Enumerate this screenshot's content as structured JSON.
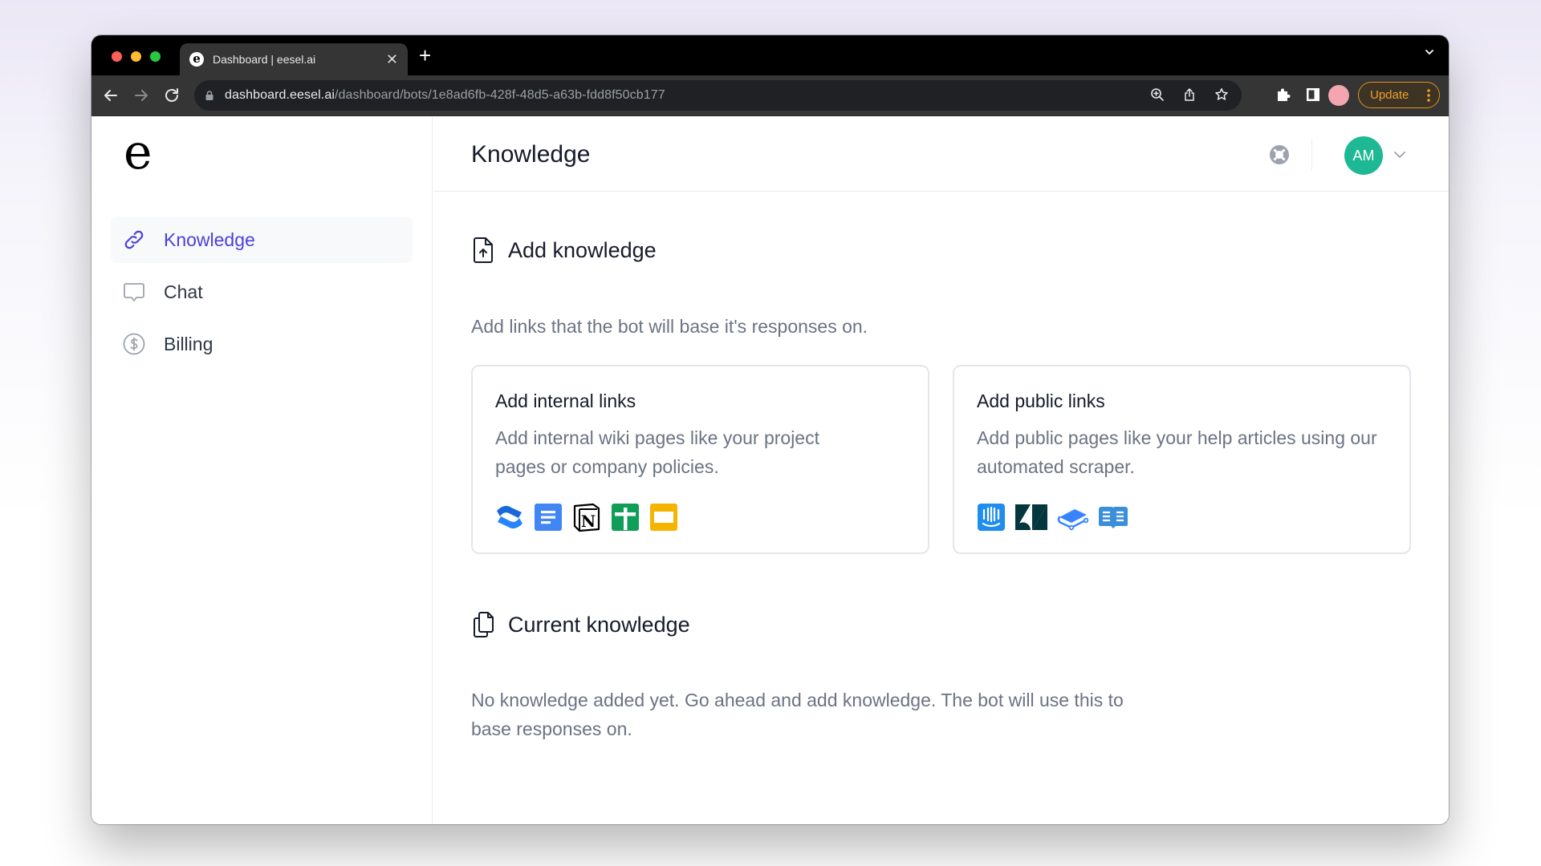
{
  "browser": {
    "tab": {
      "title": "Dashboard | eesel.ai",
      "favicon": "eesel-logo-icon"
    },
    "url": {
      "host": "dashboard.eesel.ai",
      "path": "/dashboard/bots/1e8ad6fb-428f-48d5-a63b-fdd8f50cb177"
    },
    "update_label": "Update",
    "icons": [
      "back-icon",
      "forward-icon",
      "reload-icon",
      "lock-icon",
      "zoom-icon",
      "share-icon",
      "bookmark-star-icon",
      "extensions-icon",
      "side-panel-icon",
      "profile-icon",
      "kebab-menu-icon"
    ]
  },
  "app": {
    "logo": "e",
    "sidebar": {
      "items": [
        {
          "label": "Knowledge",
          "icon": "link-icon",
          "active": true
        },
        {
          "label": "Chat",
          "icon": "chat-bubble-icon",
          "active": false
        },
        {
          "label": "Billing",
          "icon": "dollar-circle-icon",
          "active": false
        }
      ]
    },
    "header": {
      "title": "Knowledge",
      "help_icon": "lifebuoy-icon",
      "avatar_initials": "AM",
      "avatar_color": "#1fb894"
    },
    "add_knowledge": {
      "title": "Add knowledge",
      "subtitle": "Add links that the bot will base it's responses on.",
      "cards": [
        {
          "title": "Add internal links",
          "description": "Add internal wiki pages like your project pages or company policies.",
          "integrations": [
            "Confluence",
            "Google Docs",
            "Notion",
            "Google Sheets",
            "Google Slides"
          ]
        },
        {
          "title": "Add public links",
          "description": "Add public pages like your help articles using our automated scraper.",
          "integrations": [
            "Intercom",
            "Zendesk",
            "GitBook",
            "Help Center"
          ]
        }
      ]
    },
    "current_knowledge": {
      "title": "Current knowledge",
      "empty_text": "No knowledge added yet. Go ahead and add knowledge. The bot will use this to base responses on."
    },
    "colors": {
      "accent": "#4b42d6",
      "update": "#f0a02a"
    }
  }
}
